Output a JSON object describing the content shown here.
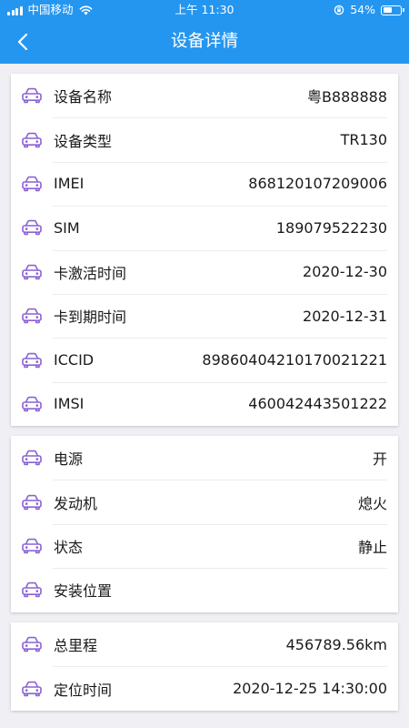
{
  "status_bar": {
    "carrier": "中国移动",
    "time": "上午 11:30",
    "battery": "54%",
    "battery_level": 0.54
  },
  "nav": {
    "title": "设备详情"
  },
  "colors": {
    "header": "#2596f0",
    "icon": "#8a63d2",
    "background": "#efeff4"
  },
  "row_icon": "car-icon",
  "device_info": {
    "rows": [
      {
        "label": "设备名称",
        "value": "粤B888888"
      },
      {
        "label": "设备类型",
        "value": "TR130"
      },
      {
        "label": "IMEI",
        "value": "868120107209006"
      },
      {
        "label": "SIM",
        "value": "189079522230"
      },
      {
        "label": "卡激活时间",
        "value": "2020-12-30"
      },
      {
        "label": "卡到期时间",
        "value": "2020-12-31"
      },
      {
        "label": "ICCID",
        "value": "89860404210170021221"
      },
      {
        "label": "IMSI",
        "value": "460042443501222"
      }
    ]
  },
  "device_status": {
    "rows": [
      {
        "label": "电源",
        "value": "开"
      },
      {
        "label": "发动机",
        "value": "熄火"
      },
      {
        "label": "状态",
        "value": "静止"
      },
      {
        "label": "安装位置",
        "value": ""
      }
    ]
  },
  "location_info": {
    "rows": [
      {
        "label": "总里程",
        "value": "456789.56km"
      },
      {
        "label": "定位时间",
        "value": "2020-12-25 14:30:00"
      }
    ]
  }
}
